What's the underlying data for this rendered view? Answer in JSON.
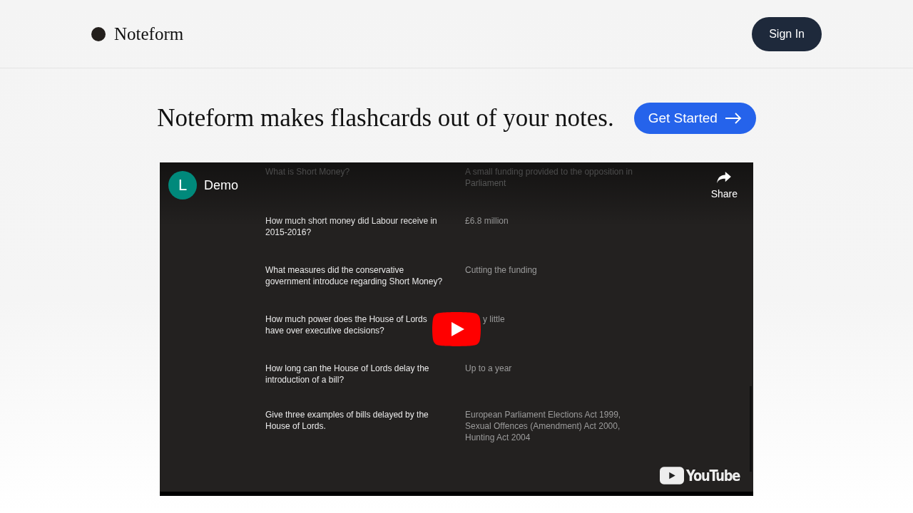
{
  "header": {
    "logo": "Noteform",
    "sign_in": "Sign In"
  },
  "hero": {
    "headline": "Noteform makes flashcards out of your notes.",
    "cta": "Get Started"
  },
  "video": {
    "channel_initial": "L",
    "title": "Demo",
    "share": "Share",
    "brand": "YouTube",
    "cards": [
      {
        "question": "What is Short Money?",
        "answer": "A small funding provided to the opposition in Parliament",
        "kind": "plain"
      },
      {
        "question": "How much short money did Labour receive in 2015-2016?",
        "answer": "£6.8 million",
        "kind": "plain"
      },
      {
        "question": "What measures did the conservative government introduce regarding Short Money?",
        "answer": "Cutting the funding",
        "kind": "plain"
      },
      {
        "question": "How much power does the House of Lords have over executive decisions?",
        "answer": "y little",
        "kind": "covered"
      },
      {
        "question": "How long can the House of Lords delay the introduction of a bill?",
        "answer": "Up to a year",
        "kind": "plain"
      },
      {
        "question": "Give three examples of bills delayed by the House of Lords.",
        "answer": "European Parliament Elections Act 1999, Sexual Offences (Amendment) Act 2000, Hunting Act 2004",
        "kind": "plain"
      }
    ]
  }
}
